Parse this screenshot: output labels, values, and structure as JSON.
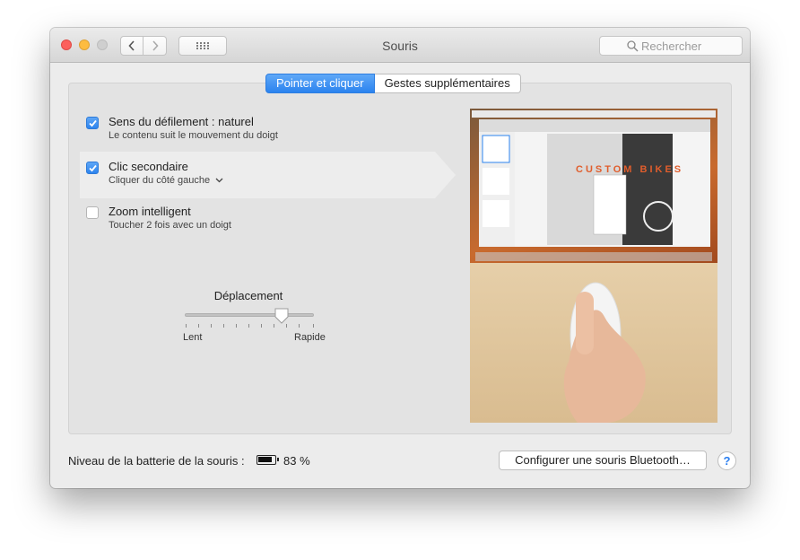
{
  "window": {
    "title": "Souris"
  },
  "toolbar": {
    "search_placeholder": "Rechercher"
  },
  "tabs": [
    {
      "label": "Pointer et cliquer",
      "active": true
    },
    {
      "label": "Gestes supplémentaires",
      "active": false
    }
  ],
  "options": [
    {
      "label": "Sens du défilement : naturel",
      "sublabel": "Le contenu suit le mouvement du doigt",
      "checked": true
    },
    {
      "label": "Clic secondaire",
      "sublabel": "Cliquer du côté gauche",
      "checked": true,
      "has_dropdown": true
    },
    {
      "label": "Zoom intelligent",
      "sublabel": "Toucher 2 fois avec un doigt",
      "checked": false
    }
  ],
  "tracking": {
    "title": "Déplacement",
    "min_label": "Lent",
    "max_label": "Rapide",
    "value": 0.75
  },
  "preview": {
    "screen_text": "CUSTOM BIKES"
  },
  "footer": {
    "battery_label": "Niveau de la batterie de la souris :",
    "battery_percent": "83 %",
    "battery_level": 0.83,
    "bluetooth_button": "Configurer une souris Bluetooth…",
    "help": "?"
  },
  "colors": {
    "accent": "#2b83ef",
    "close": "#fc605c",
    "minimize": "#fdbc40"
  }
}
